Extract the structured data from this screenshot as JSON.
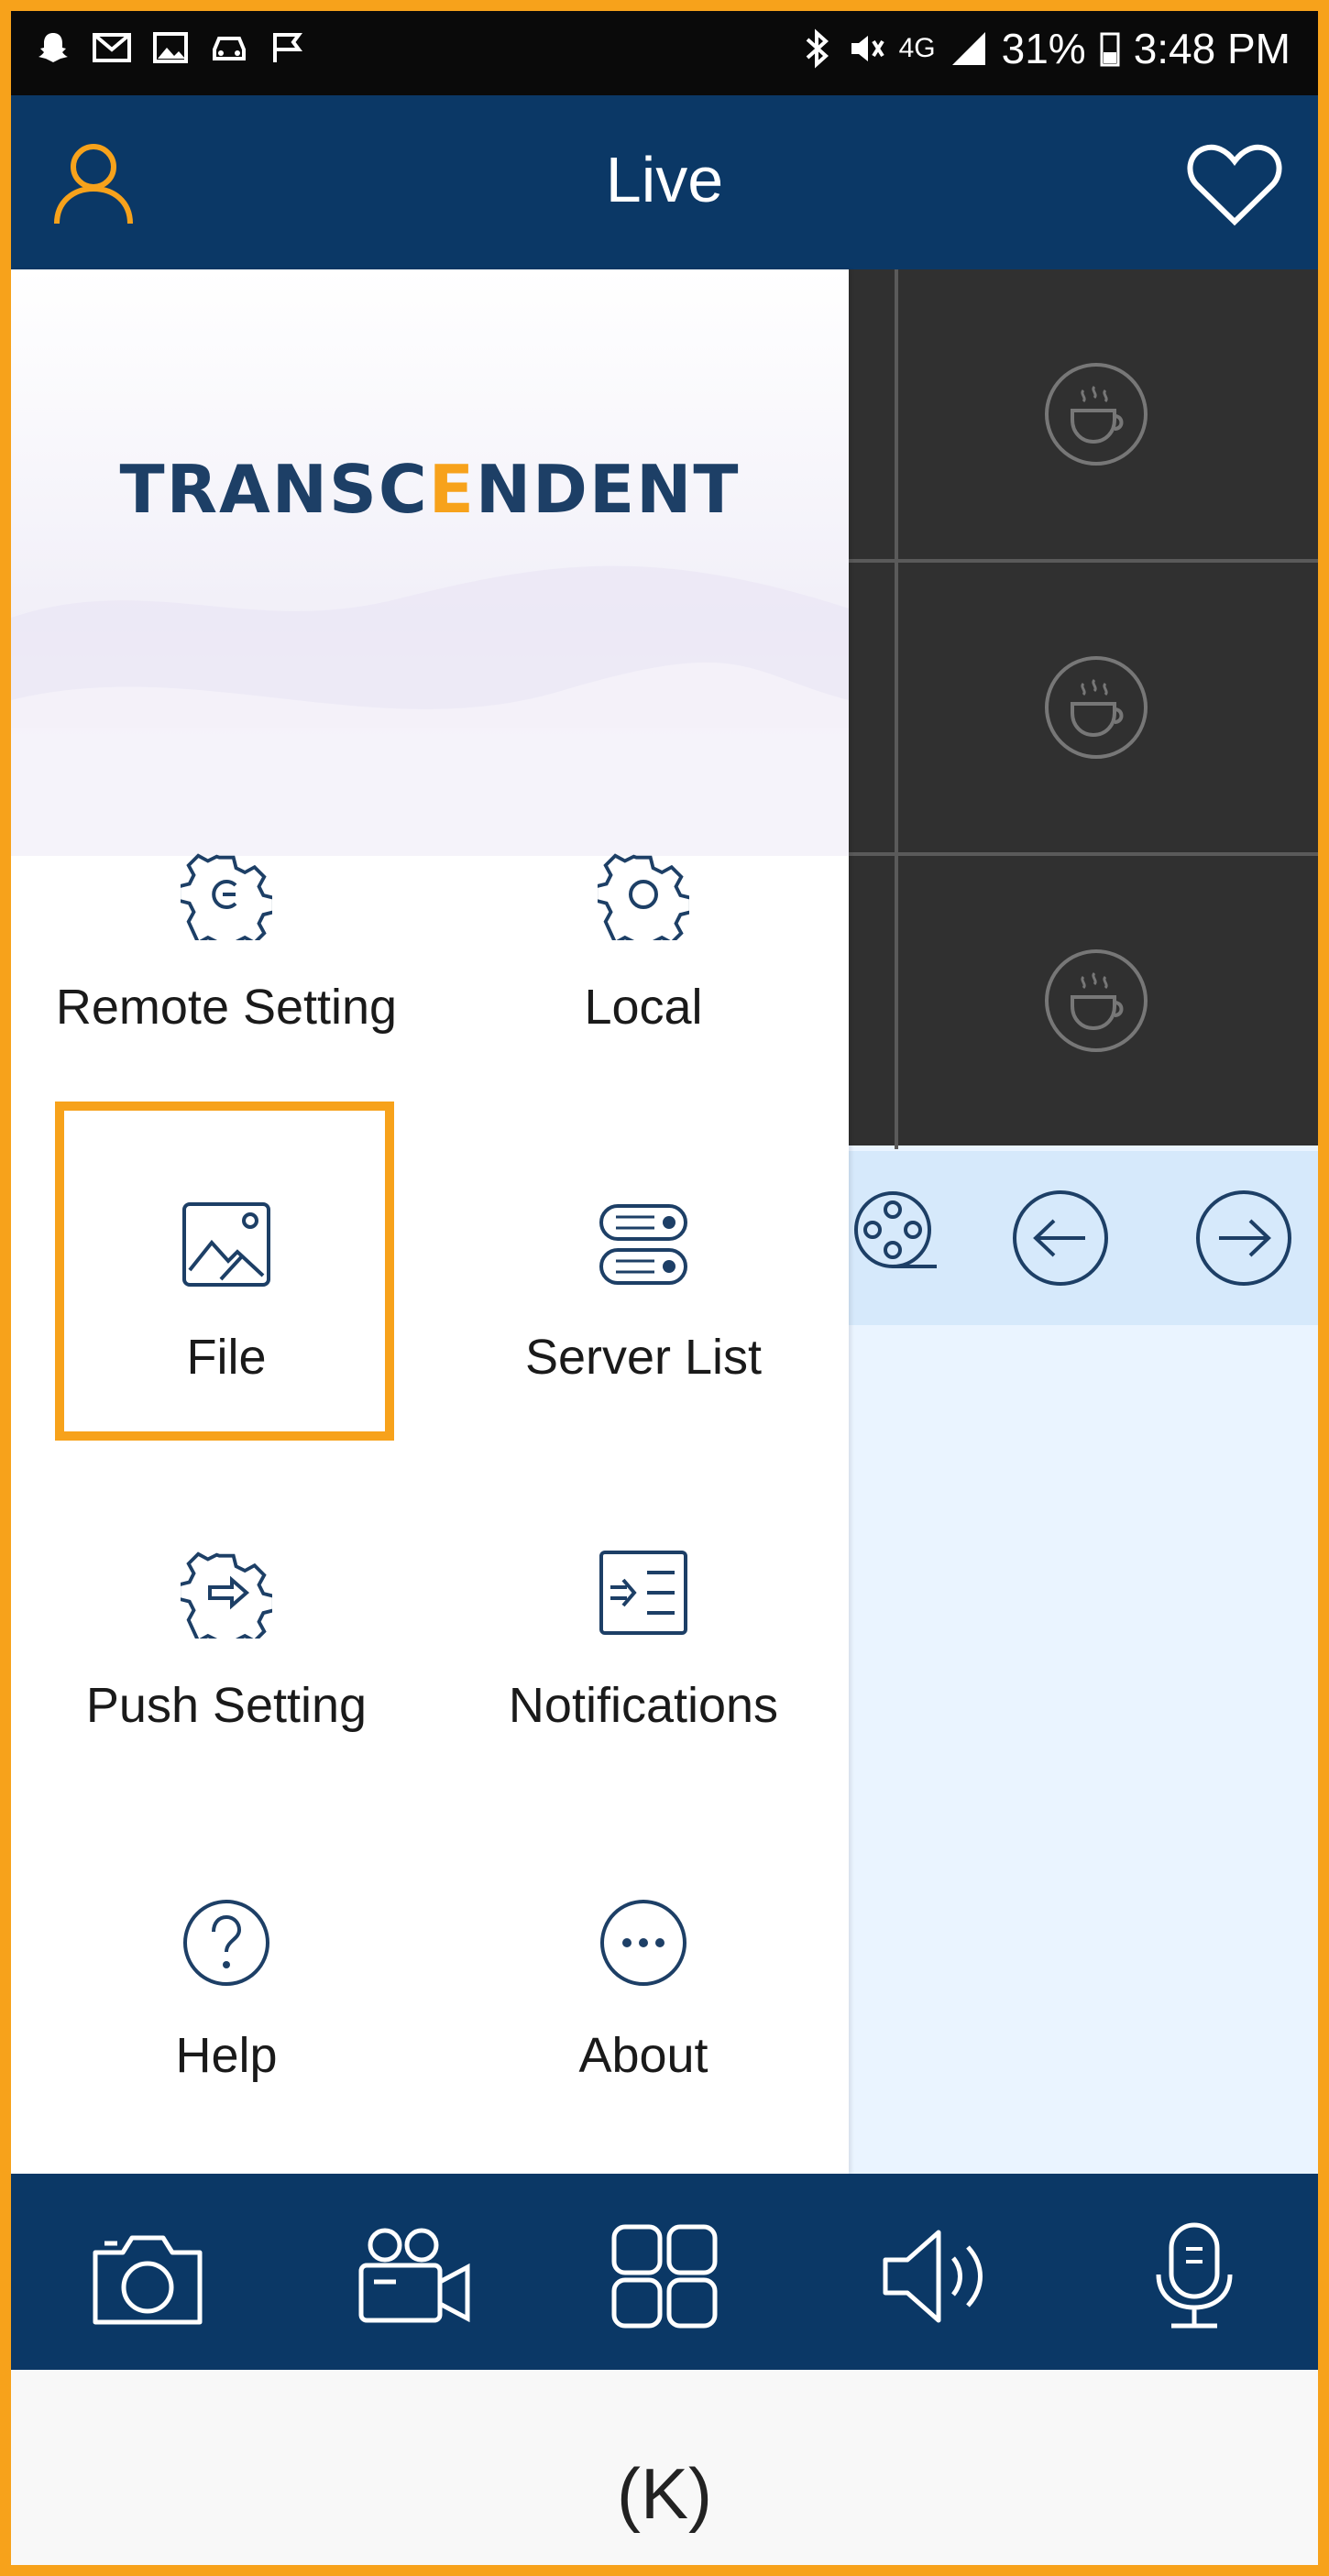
{
  "status_bar": {
    "time": "3:48 PM",
    "battery": "31%",
    "network": "4G"
  },
  "header": {
    "title": "Live",
    "left_icon": "user-icon",
    "right_icon": "heart-icon"
  },
  "drawer": {
    "brand": "TRANSCENDENT",
    "items": [
      {
        "label": "Remote Setting",
        "icon": "remote-setting-gear-icon"
      },
      {
        "label": "Local",
        "icon": "local-gear-icon"
      },
      {
        "label": "File",
        "icon": "image-file-icon",
        "highlighted": true
      },
      {
        "label": "Server List",
        "icon": "server-list-icon"
      },
      {
        "label": "Push Setting",
        "icon": "push-setting-gear-icon"
      },
      {
        "label": "Notifications",
        "icon": "notifications-icon"
      },
      {
        "label": "Help",
        "icon": "help-icon"
      },
      {
        "label": "About",
        "icon": "more-icon"
      }
    ]
  },
  "live_panel": {
    "cameras": [
      "cup-icon",
      "cup-icon",
      "cup-icon"
    ],
    "nav_buttons": [
      "film-reel-icon",
      "arrow-left-icon",
      "arrow-right-icon"
    ]
  },
  "toolbar": {
    "buttons": [
      "camera-icon",
      "video-camera-icon",
      "grid-layout-icon",
      "speaker-icon",
      "microphone-icon"
    ]
  },
  "caption": "(K)",
  "colors": {
    "accent": "#f7a21b",
    "navy": "#0b3866",
    "icon_blue": "#1d3f66"
  }
}
